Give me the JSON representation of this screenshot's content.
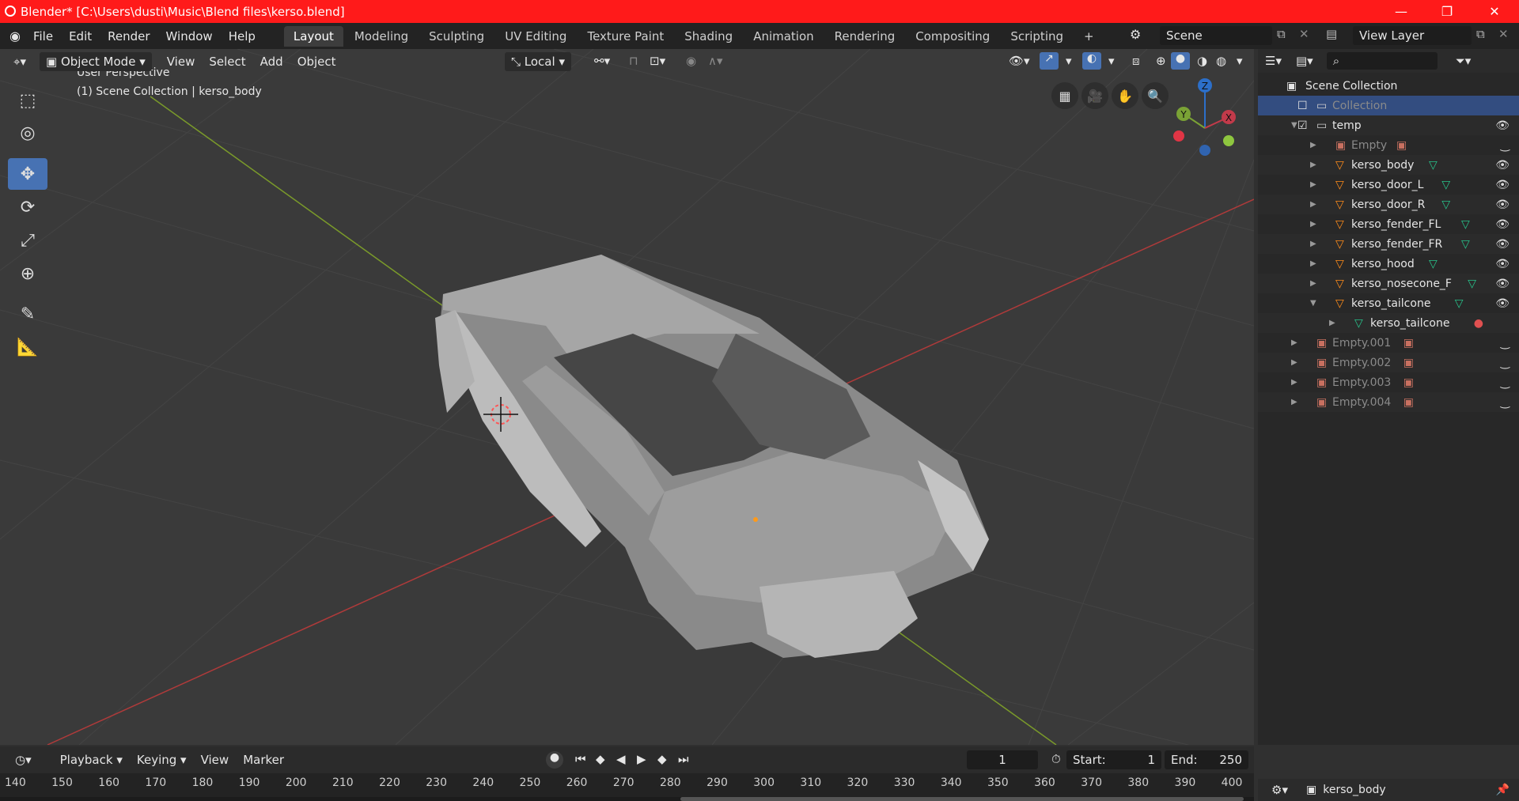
{
  "window": {
    "title": "Blender* [C:\\Users\\dusti\\Music\\Blend files\\kerso.blend]",
    "minimize": "—",
    "restore": "❐",
    "close": "✕"
  },
  "menu": [
    "File",
    "Edit",
    "Render",
    "Window",
    "Help"
  ],
  "workspaces": [
    "Layout",
    "Modeling",
    "Sculpting",
    "UV Editing",
    "Texture Paint",
    "Shading",
    "Animation",
    "Rendering",
    "Compositing",
    "Scripting"
  ],
  "add_workspace": "+",
  "scene": {
    "label": "Scene",
    "view_layer": "View Layer"
  },
  "viewport_header": {
    "mode": "Object Mode",
    "menus": [
      "View",
      "Select",
      "Add",
      "Object"
    ],
    "orientation": "Local"
  },
  "viewport": {
    "perspective": "User Perspective",
    "collection_info": "(1) Scene Collection | kerso_body",
    "gizmo": {
      "z": "Z",
      "y": "Y",
      "x": "X"
    }
  },
  "outliner": {
    "root": "Scene Collection",
    "rows": [
      {
        "name": "Collection",
        "indent": 0,
        "type": "collection",
        "selected": true,
        "dim": true
      },
      {
        "name": "temp",
        "indent": 0,
        "type": "collection",
        "eye": true
      },
      {
        "name": "Empty",
        "indent": 1,
        "type": "empty",
        "dim": true
      },
      {
        "name": "kerso_body",
        "indent": 1,
        "type": "mesh",
        "eye": true
      },
      {
        "name": "kerso_door_L",
        "indent": 1,
        "type": "mesh",
        "eye": true
      },
      {
        "name": "kerso_door_R",
        "indent": 1,
        "type": "mesh",
        "eye": true
      },
      {
        "name": "kerso_fender_FL",
        "indent": 1,
        "type": "mesh",
        "eye": true
      },
      {
        "name": "kerso_fender_FR",
        "indent": 1,
        "type": "mesh",
        "eye": true
      },
      {
        "name": "kerso_hood",
        "indent": 1,
        "type": "mesh",
        "eye": true
      },
      {
        "name": "kerso_nosecone_F",
        "indent": 1,
        "type": "mesh",
        "eye": true
      },
      {
        "name": "kerso_tailcone",
        "indent": 1,
        "type": "mesh",
        "eye": true
      },
      {
        "name": "kerso_tailcone",
        "indent": 2,
        "type": "meshdata"
      },
      {
        "name": "Empty.001",
        "indent": 0,
        "type": "empty",
        "dim": true
      },
      {
        "name": "Empty.002",
        "indent": 0,
        "type": "empty",
        "dim": true
      },
      {
        "name": "Empty.003",
        "indent": 0,
        "type": "empty",
        "dim": true
      },
      {
        "name": "Empty.004",
        "indent": 0,
        "type": "empty",
        "dim": true
      }
    ]
  },
  "timeline": {
    "menus": [
      "Playback",
      "Keying",
      "View",
      "Marker"
    ],
    "current_frame": "1",
    "start_label": "Start:",
    "start": "1",
    "end_label": "End:",
    "end": "250",
    "ticks": [
      "140",
      "150",
      "160",
      "170",
      "180",
      "190",
      "200",
      "210",
      "220",
      "230",
      "240",
      "250",
      "260",
      "270",
      "280",
      "290",
      "300",
      "310",
      "320",
      "330",
      "340",
      "350",
      "360",
      "370",
      "380",
      "390",
      "400"
    ]
  },
  "properties": {
    "active_object": "kerso_body"
  },
  "colors": {
    "titlebar": "#ff1a1a",
    "accent": "#4772b3",
    "mesh_icon": "#ff8c1a",
    "data_icon": "#28c28a"
  }
}
